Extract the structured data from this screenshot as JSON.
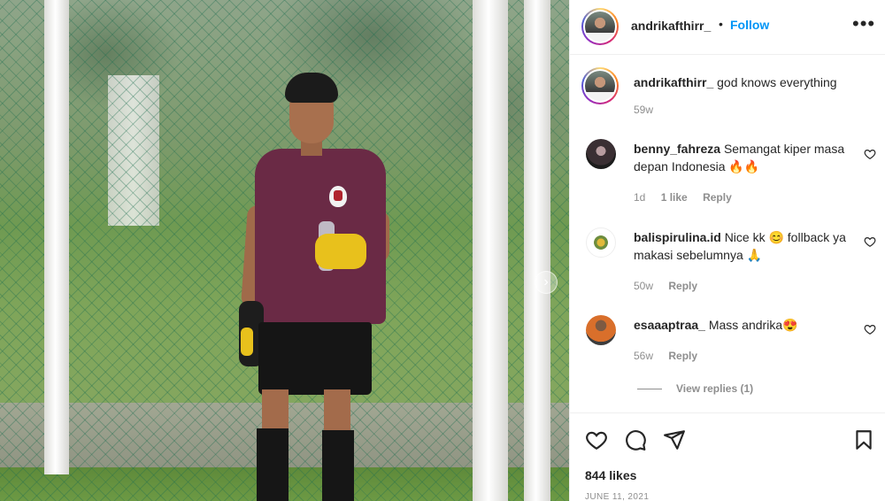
{
  "post": {
    "username": "andrikafthirr_",
    "separator": "•",
    "follow_label": "Follow",
    "more_label": "•••",
    "caption": "god knows everything",
    "caption_time": "59w",
    "likes": "844 likes",
    "date": "JUNE 11, 2021"
  },
  "carousel": {
    "next_label": "›"
  },
  "comments": [
    {
      "username": "benny_fahreza",
      "text": "Semangat kiper masa depan Indonesia 🔥🔥",
      "time": "1d",
      "likes": "1 like",
      "reply_label": "Reply"
    },
    {
      "username": "balispirulina.id",
      "text": "Nice kk 😊 follback ya makasi sebelumnya 🙏",
      "time": "50w",
      "reply_label": "Reply"
    },
    {
      "username": "esaaaptraa_",
      "text": "Mass andrika😍",
      "time": "56w",
      "reply_label": "Reply",
      "view_replies": "View replies (1)"
    }
  ],
  "icons": [
    "heart-icon",
    "comment-icon",
    "share-icon",
    "bookmark-icon",
    "more-options-icon",
    "chevron-right-icon"
  ],
  "colors": {
    "link_blue": "#0095f6",
    "secondary_text": "#8e8e8e",
    "primary_text": "#262626"
  }
}
